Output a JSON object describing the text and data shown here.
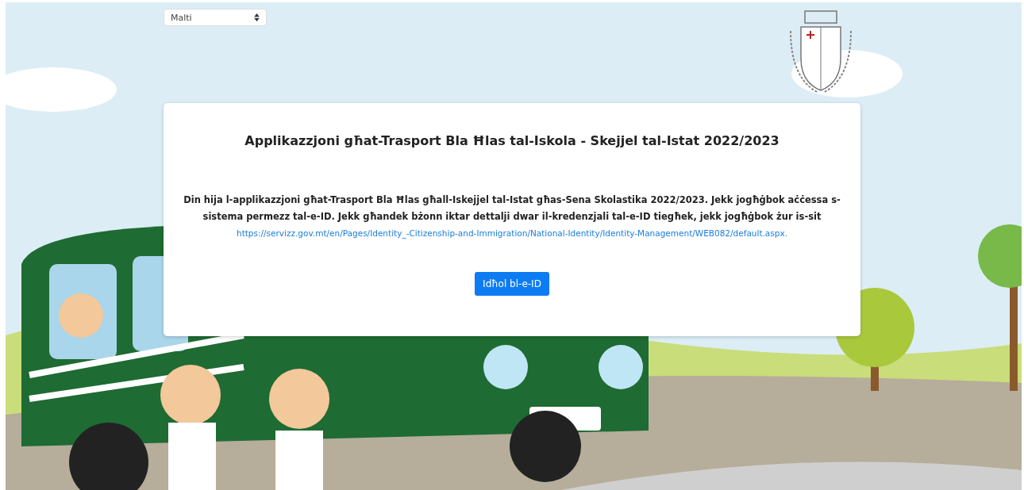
{
  "language_select": {
    "value": "Malti"
  },
  "card": {
    "title": "Applikazzjoni għat-Trasport Bla Ħlas tal-Iskola - Skejjel tal-Istat 2022/2023",
    "description": "Din hija l-applikazzjoni għat-Trasport Bla Ħlas għall-Iskejjel tal-Istat għas-Sena Skolastika 2022/2023. Jekk jogħġbok aċċessa s-sistema permezz tal-e-ID. Jekk għandek bżonn iktar dettalji dwar il-kredenzjali tal-e-ID tiegħek, jekk jogħġbok żur is-sit",
    "link": "https://servizz.gov.mt/en/Pages/Identity_-Citizenship-and-Immigration/National-Identity/Identity-Management/WEB082/default.aspx.",
    "button": "Idħol bl-e-ID"
  }
}
